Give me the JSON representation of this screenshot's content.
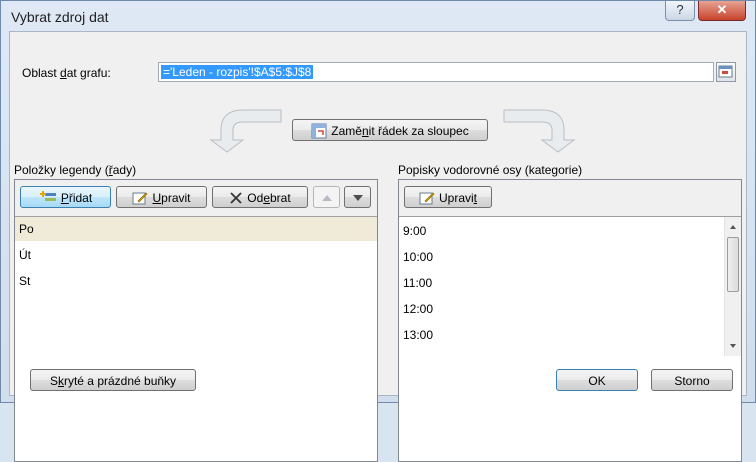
{
  "window": {
    "title": "Vybrat zdroj dat",
    "help_glyph": "?",
    "close_glyph": "✕"
  },
  "range": {
    "label_pre": "Oblast ",
    "label_key": "d",
    "label_post": "at grafu:",
    "value": "='Leden - rozpis'!$A$5:$J$8"
  },
  "switch": {
    "label_pre": "Zamě",
    "label_key": "n",
    "label_post": "it řádek za sloupec"
  },
  "legend": {
    "title_pre": "Položky legendy (",
    "title_key": "ř",
    "title_post": "ady)",
    "add_pre": "",
    "add_key": "P",
    "add_post": "řidat",
    "edit_pre": "",
    "edit_key": "U",
    "edit_post": "pravit",
    "remove_pre": "Od",
    "remove_key": "e",
    "remove_post": "brat",
    "items": [
      "Po",
      "Út",
      "St"
    ]
  },
  "axis": {
    "title_pre": "Popisky vodorovné osy (kate",
    "title_key": "g",
    "title_post": "orie)",
    "edit_pre": "Upravi",
    "edit_key": "t",
    "edit_post": "",
    "items": [
      "9:00",
      "10:00",
      "11:00",
      "12:00",
      "13:00"
    ]
  },
  "footer": {
    "hidden_pre": "S",
    "hidden_key": "k",
    "hidden_post": "ryté a prázdné buňky",
    "ok": "OK",
    "cancel": "Storno"
  },
  "colors": {
    "selection": "#3399ff",
    "selected_row": "#f0ead9",
    "close": "#c7432d"
  }
}
